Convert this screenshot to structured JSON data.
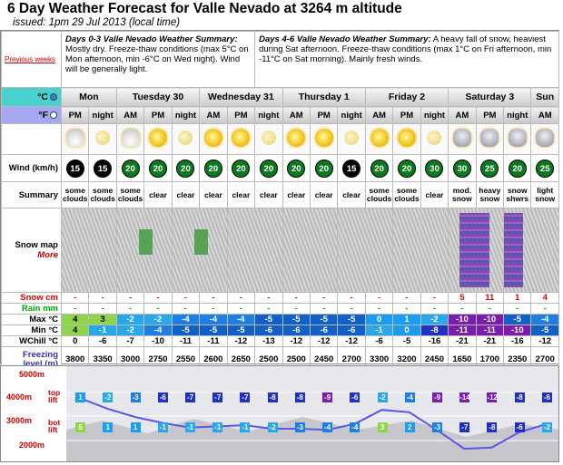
{
  "header": {
    "title": "6 Day Weather Forecast for Valle Nevado at 3264 m altitude",
    "issued": "issued: 1pm 29 Jul 2013 (local time)"
  },
  "summary": {
    "prev_link": "Previous weeks",
    "days03_title": "Days 0-3 Valle Nevado Weather Summary:",
    "days03_text": " Mostly dry. Freeze-thaw conditions (max 5°C on Mon afternoon, min -6°C on Wed night). Wind will be generally light.",
    "days46_title": "Days 4-6 Valle Nevado Weather Summary:",
    "days46_text": " A heavy fall of snow, heaviest during Sat afternoon. Freeze-thaw conditions (max 1°C on Fri afternoon, min -11°C on Sat morning). Mainly fresh winds."
  },
  "units": {
    "c": "°C",
    "f": "°F"
  },
  "days": [
    {
      "name": "Mon",
      "span": 2
    },
    {
      "name": "Tuesday 30",
      "span": 3
    },
    {
      "name": "Wednesday 31",
      "span": 3
    },
    {
      "name": "Thursday 1",
      "span": 3
    },
    {
      "name": "Friday 2",
      "span": 3
    },
    {
      "name": "Saturday 3",
      "span": 3
    },
    {
      "name": "Sun",
      "span": 1
    }
  ],
  "periods": [
    "PM",
    "night",
    "AM",
    "PM",
    "night",
    "AM",
    "PM",
    "night",
    "AM",
    "PM",
    "night",
    "AM",
    "PM",
    "night",
    "AM",
    "PM",
    "night",
    "AM"
  ],
  "icons": [
    "cloud-sun",
    "cloud-moon",
    "cloud-sun",
    "sun",
    "moon",
    "sun",
    "sun",
    "moon",
    "sun",
    "sun",
    "moon",
    "sun",
    "sun",
    "moon",
    "snow",
    "snow",
    "snow",
    "snow"
  ],
  "row_labels": {
    "wind": "Wind (km/h)",
    "summary": "Summary",
    "snowmap": "Snow map",
    "more": "More",
    "snow": "Snow cm",
    "rain": "Rain mm",
    "max": "Max °C",
    "min": "Min °C",
    "wchill": "WChill °C",
    "freezing": "Freezing level (m)"
  },
  "wind": [
    "15",
    "15",
    "20",
    "20",
    "20",
    "20",
    "20",
    "20",
    "20",
    "20",
    "15",
    "20",
    "20",
    "30",
    "30",
    "25",
    "20",
    "25"
  ],
  "summary_text": [
    "some clouds",
    "some clouds",
    "some clouds",
    "clear",
    "clear",
    "clear",
    "clear",
    "clear",
    "clear",
    "clear",
    "clear",
    "some clouds",
    "some clouds",
    "clear",
    "mod. snow",
    "heavy snow",
    "snow shwrs",
    "light snow"
  ],
  "snow": [
    "-",
    "-",
    "-",
    "-",
    "-",
    "-",
    "-",
    "-",
    "-",
    "-",
    "-",
    "-",
    "-",
    "-",
    "5",
    "11",
    "1",
    "4"
  ],
  "rain": [
    "-",
    "-",
    "-",
    "-",
    "-",
    "-",
    "-",
    "-",
    "-",
    "-",
    "-",
    "-",
    "-",
    "-",
    "-",
    "-",
    "-",
    "-"
  ],
  "max": [
    "4",
    "3",
    "-2",
    "-2",
    "-4",
    "-4",
    "-4",
    "-5",
    "-5",
    "-5",
    "-5",
    "0",
    "1",
    "-2",
    "-10",
    "-10",
    "-5",
    "-4"
  ],
  "min": [
    "4",
    "-1",
    "-2",
    "-4",
    "-5",
    "-5",
    "-5",
    "-6",
    "-6",
    "-6",
    "-6",
    "-1",
    "0",
    "-8",
    "-11",
    "-11",
    "-10",
    "-5"
  ],
  "wchill": [
    "0",
    "-6",
    "-7",
    "-10",
    "-11",
    "-11",
    "-12",
    "-13",
    "-12",
    "-12",
    "-12",
    "-6",
    "-5",
    "-16",
    "-21",
    "-21",
    "-16",
    "-12"
  ],
  "freezing": [
    "3800",
    "3350",
    "3000",
    "2750",
    "2550",
    "2600",
    "2650",
    "2500",
    "2500",
    "2450",
    "2700",
    "3300",
    "3200",
    "2450",
    "1650",
    "1700",
    "2350",
    "2700"
  ],
  "profile": {
    "alt_5000": "5000m",
    "alt_4000": "4000m",
    "alt_3000": "3000m",
    "alt_2000": "2000m",
    "top_lift": "top lift",
    "bot_lift": "bot lift",
    "top_vals": [
      "1",
      "-2",
      "-3",
      "-6",
      "-7",
      "-7",
      "-7",
      "-8",
      "-8",
      "-9",
      "-6",
      "-2",
      "-4",
      "-9",
      "-14",
      "-12",
      "-8",
      "-6"
    ],
    "bot_vals": [
      "5",
      "1",
      "1",
      "-1",
      "-1",
      "-1",
      "-1",
      "-2",
      "-3",
      "-4",
      "-4",
      "3",
      "2",
      "-3",
      "-7",
      "-8",
      "-6",
      "-2"
    ]
  }
}
